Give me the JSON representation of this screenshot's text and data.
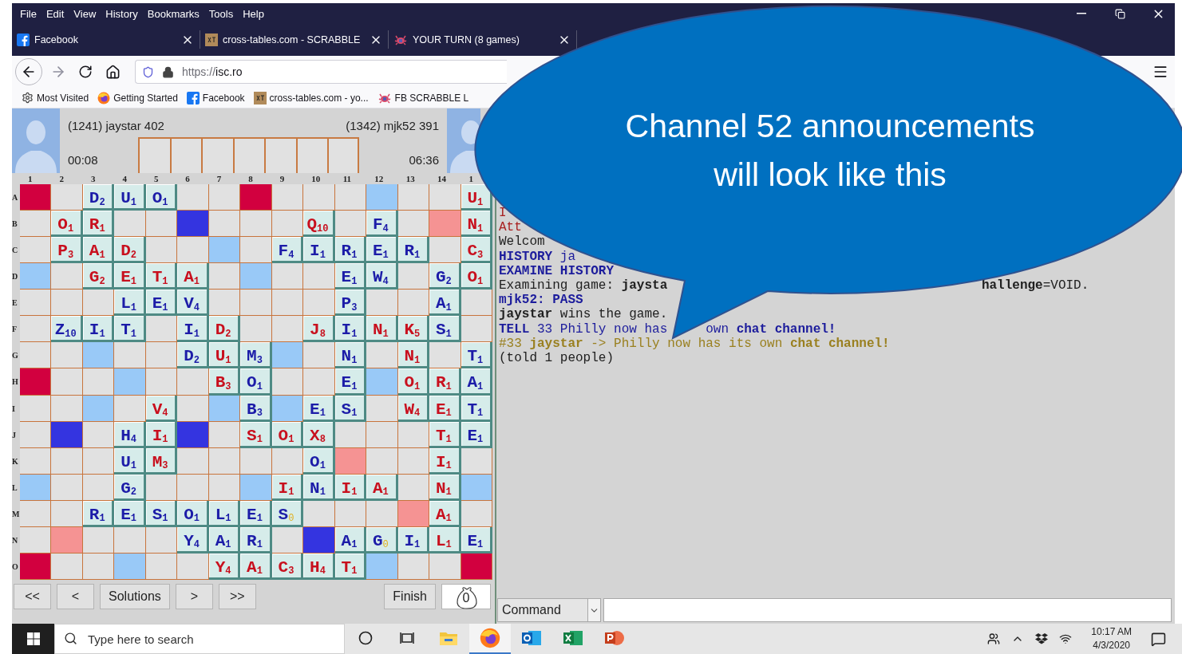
{
  "menu": [
    "File",
    "Edit",
    "View",
    "History",
    "Bookmarks",
    "Tools",
    "Help"
  ],
  "tabs": [
    {
      "kind": "facebook",
      "title": "Facebook",
      "selected": false
    },
    {
      "kind": "xt",
      "title": "cross-tables.com - SCRABBLE",
      "selected": false
    },
    {
      "kind": "crab",
      "title": "YOUR TURN (8 games)",
      "selected": false
    }
  ],
  "address": {
    "scheme": "https://",
    "host": "isc.ro"
  },
  "bookmarks": [
    {
      "kind": "gear",
      "label": "Most Visited"
    },
    {
      "kind": "firefox",
      "label": "Getting Started"
    },
    {
      "kind": "facebook",
      "label": "Facebook"
    },
    {
      "kind": "xt",
      "label": "cross-tables.com - yo..."
    },
    {
      "kind": "crab",
      "label": "FB SCRABBLE L"
    }
  ],
  "players": [
    {
      "name": "(1241) jaystar 402",
      "clock": "00:08"
    },
    {
      "name": "(1342) mjk52 391",
      "clock": "06:36"
    }
  ],
  "columns": [
    "1",
    "2",
    "3",
    "4",
    "5",
    "6",
    "7",
    "8",
    "9",
    "10",
    "11",
    "12",
    "13",
    "14",
    "1"
  ],
  "rows": [
    {
      "label": "A",
      "cells": [
        {
          "kind": "tw"
        },
        {
          "kind": "plain"
        },
        {
          "kind": "tile",
          "letter": "D",
          "points": "2",
          "color": "#1c1ca8"
        },
        {
          "kind": "tile",
          "letter": "U",
          "points": "1",
          "color": "#1c1ca8"
        },
        {
          "kind": "tile",
          "letter": "O",
          "points": "1",
          "color": "#1c1ca8"
        },
        {
          "kind": "plain"
        },
        {
          "kind": "plain"
        },
        {
          "kind": "tw"
        },
        {
          "kind": "plain"
        },
        {
          "kind": "plain"
        },
        {
          "kind": "plain"
        },
        {
          "kind": "dl"
        },
        {
          "kind": "plain"
        },
        {
          "kind": "plain"
        },
        {
          "kind": "tile",
          "letter": "U",
          "points": "1",
          "color": "#c8101e"
        }
      ]
    },
    {
      "label": "B",
      "cells": [
        {
          "kind": "plain"
        },
        {
          "kind": "tile",
          "letter": "O",
          "points": "1",
          "color": "#c8101e"
        },
        {
          "kind": "tile",
          "letter": "R",
          "points": "1",
          "color": "#c8101e"
        },
        {
          "kind": "plain"
        },
        {
          "kind": "plain"
        },
        {
          "kind": "tl"
        },
        {
          "kind": "plain"
        },
        {
          "kind": "plain"
        },
        {
          "kind": "plain"
        },
        {
          "kind": "tile",
          "letter": "Q",
          "points": "10",
          "color": "#c8101e"
        },
        {
          "kind": "plain"
        },
        {
          "kind": "tile",
          "letter": "F",
          "points": "4",
          "color": "#1c1ca8"
        },
        {
          "kind": "plain"
        },
        {
          "kind": "dw"
        },
        {
          "kind": "tile",
          "letter": "N",
          "points": "1",
          "color": "#c8101e"
        }
      ]
    },
    {
      "label": "C",
      "cells": [
        {
          "kind": "plain"
        },
        {
          "kind": "tile",
          "letter": "P",
          "points": "3",
          "color": "#c8101e"
        },
        {
          "kind": "tile",
          "letter": "A",
          "points": "1",
          "color": "#c8101e"
        },
        {
          "kind": "tile",
          "letter": "D",
          "points": "2",
          "color": "#c8101e"
        },
        {
          "kind": "plain"
        },
        {
          "kind": "plain"
        },
        {
          "kind": "dl"
        },
        {
          "kind": "plain"
        },
        {
          "kind": "tile",
          "letter": "F",
          "points": "4",
          "color": "#1c1ca8"
        },
        {
          "kind": "tile",
          "letter": "I",
          "points": "1",
          "color": "#1c1ca8"
        },
        {
          "kind": "tile",
          "letter": "R",
          "points": "1",
          "color": "#1c1ca8"
        },
        {
          "kind": "tile",
          "letter": "E",
          "points": "1",
          "color": "#1c1ca8"
        },
        {
          "kind": "tile",
          "letter": "R",
          "points": "1",
          "color": "#1c1ca8"
        },
        {
          "kind": "plain"
        },
        {
          "kind": "tile",
          "letter": "C",
          "points": "3",
          "color": "#c8101e"
        }
      ]
    },
    {
      "label": "D",
      "cells": [
        {
          "kind": "dl"
        },
        {
          "kind": "plain"
        },
        {
          "kind": "tile",
          "letter": "G",
          "points": "2",
          "color": "#c8101e"
        },
        {
          "kind": "tile",
          "letter": "E",
          "points": "1",
          "color": "#c8101e"
        },
        {
          "kind": "tile",
          "letter": "T",
          "points": "1",
          "color": "#c8101e"
        },
        {
          "kind": "tile",
          "letter": "A",
          "points": "1",
          "color": "#c8101e"
        },
        {
          "kind": "plain"
        },
        {
          "kind": "dl"
        },
        {
          "kind": "plain"
        },
        {
          "kind": "plain"
        },
        {
          "kind": "tile",
          "letter": "E",
          "points": "1",
          "color": "#1c1ca8"
        },
        {
          "kind": "tile",
          "letter": "W",
          "points": "4",
          "color": "#1c1ca8"
        },
        {
          "kind": "plain"
        },
        {
          "kind": "tile",
          "letter": "G",
          "points": "2",
          "color": "#1c1ca8"
        },
        {
          "kind": "tile",
          "letter": "O",
          "points": "1",
          "color": "#c8101e"
        }
      ]
    },
    {
      "label": "E",
      "cells": [
        {
          "kind": "plain"
        },
        {
          "kind": "plain"
        },
        {
          "kind": "plain"
        },
        {
          "kind": "tile",
          "letter": "L",
          "points": "1",
          "color": "#1c1ca8"
        },
        {
          "kind": "tile",
          "letter": "E",
          "points": "1",
          "color": "#1c1ca8"
        },
        {
          "kind": "tile",
          "letter": "V",
          "points": "4",
          "color": "#1c1ca8"
        },
        {
          "kind": "plain"
        },
        {
          "kind": "plain"
        },
        {
          "kind": "plain"
        },
        {
          "kind": "plain"
        },
        {
          "kind": "tile",
          "letter": "P",
          "points": "3",
          "color": "#1c1ca8"
        },
        {
          "kind": "plain"
        },
        {
          "kind": "plain"
        },
        {
          "kind": "tile",
          "letter": "A",
          "points": "1",
          "color": "#1c1ca8"
        },
        {
          "kind": "plain"
        }
      ]
    },
    {
      "label": "F",
      "cells": [
        {
          "kind": "plain"
        },
        {
          "kind": "tile",
          "letter": "Z",
          "points": "10",
          "color": "#1c1ca8"
        },
        {
          "kind": "tile",
          "letter": "I",
          "points": "1",
          "color": "#1c1ca8"
        },
        {
          "kind": "tile",
          "letter": "T",
          "points": "1",
          "color": "#1c1ca8"
        },
        {
          "kind": "plain"
        },
        {
          "kind": "tile",
          "letter": "I",
          "points": "1",
          "color": "#1c1ca8"
        },
        {
          "kind": "tile",
          "letter": "D",
          "points": "2",
          "color": "#c8101e"
        },
        {
          "kind": "plain"
        },
        {
          "kind": "plain"
        },
        {
          "kind": "tile",
          "letter": "J",
          "points": "8",
          "color": "#c8101e"
        },
        {
          "kind": "tile",
          "letter": "I",
          "points": "1",
          "color": "#1c1ca8"
        },
        {
          "kind": "tile",
          "letter": "N",
          "points": "1",
          "color": "#c8101e"
        },
        {
          "kind": "tile",
          "letter": "K",
          "points": "5",
          "color": "#c8101e"
        },
        {
          "kind": "tile",
          "letter": "S",
          "points": "1",
          "color": "#1c1ca8"
        },
        {
          "kind": "plain"
        }
      ]
    },
    {
      "label": "G",
      "cells": [
        {
          "kind": "plain"
        },
        {
          "kind": "plain"
        },
        {
          "kind": "dl"
        },
        {
          "kind": "plain"
        },
        {
          "kind": "plain"
        },
        {
          "kind": "tile",
          "letter": "D",
          "points": "2",
          "color": "#1c1ca8"
        },
        {
          "kind": "tile",
          "letter": "U",
          "points": "1",
          "color": "#c8101e"
        },
        {
          "kind": "tile",
          "letter": "M",
          "points": "3",
          "color": "#1c1ca8"
        },
        {
          "kind": "dl"
        },
        {
          "kind": "plain"
        },
        {
          "kind": "tile",
          "letter": "N",
          "points": "1",
          "color": "#1c1ca8"
        },
        {
          "kind": "plain"
        },
        {
          "kind": "tile",
          "letter": "N",
          "points": "1",
          "color": "#c8101e"
        },
        {
          "kind": "plain"
        },
        {
          "kind": "tile",
          "letter": "T",
          "points": "1",
          "color": "#1c1ca8"
        }
      ]
    },
    {
      "label": "H",
      "cells": [
        {
          "kind": "tw"
        },
        {
          "kind": "plain"
        },
        {
          "kind": "plain"
        },
        {
          "kind": "dl"
        },
        {
          "kind": "plain"
        },
        {
          "kind": "plain"
        },
        {
          "kind": "tile",
          "letter": "B",
          "points": "3",
          "color": "#c8101e"
        },
        {
          "kind": "tile",
          "letter": "O",
          "points": "1",
          "color": "#1c1ca8"
        },
        {
          "kind": "plain"
        },
        {
          "kind": "plain"
        },
        {
          "kind": "tile",
          "letter": "E",
          "points": "1",
          "color": "#1c1ca8"
        },
        {
          "kind": "dl"
        },
        {
          "kind": "tile",
          "letter": "O",
          "points": "1",
          "color": "#c8101e"
        },
        {
          "kind": "tile",
          "letter": "R",
          "points": "1",
          "color": "#c8101e"
        },
        {
          "kind": "tile",
          "letter": "A",
          "points": "1",
          "color": "#1c1ca8"
        }
      ]
    },
    {
      "label": "I",
      "cells": [
        {
          "kind": "plain"
        },
        {
          "kind": "plain"
        },
        {
          "kind": "dl"
        },
        {
          "kind": "plain"
        },
        {
          "kind": "tile",
          "letter": "V",
          "points": "4",
          "color": "#c8101e"
        },
        {
          "kind": "plain"
        },
        {
          "kind": "dl"
        },
        {
          "kind": "tile",
          "letter": "B",
          "points": "3",
          "color": "#1c1ca8"
        },
        {
          "kind": "dl"
        },
        {
          "kind": "tile",
          "letter": "E",
          "points": "1",
          "color": "#1c1ca8"
        },
        {
          "kind": "tile",
          "letter": "S",
          "points": "1",
          "color": "#1c1ca8"
        },
        {
          "kind": "plain"
        },
        {
          "kind": "tile",
          "letter": "W",
          "points": "4",
          "color": "#c8101e"
        },
        {
          "kind": "tile",
          "letter": "E",
          "points": "1",
          "color": "#c8101e"
        },
        {
          "kind": "tile",
          "letter": "T",
          "points": "1",
          "color": "#1c1ca8"
        }
      ]
    },
    {
      "label": "J",
      "cells": [
        {
          "kind": "plain"
        },
        {
          "kind": "tl"
        },
        {
          "kind": "plain"
        },
        {
          "kind": "tile",
          "letter": "H",
          "points": "4",
          "color": "#1c1ca8"
        },
        {
          "kind": "tile",
          "letter": "I",
          "points": "1",
          "color": "#c8101e"
        },
        {
          "kind": "tl"
        },
        {
          "kind": "plain"
        },
        {
          "kind": "tile",
          "letter": "S",
          "points": "1",
          "color": "#c8101e"
        },
        {
          "kind": "tile",
          "letter": "O",
          "points": "1",
          "color": "#c8101e"
        },
        {
          "kind": "tile",
          "letter": "X",
          "points": "8",
          "color": "#c8101e"
        },
        {
          "kind": "plain"
        },
        {
          "kind": "plain"
        },
        {
          "kind": "plain"
        },
        {
          "kind": "tile",
          "letter": "T",
          "points": "1",
          "color": "#c8101e"
        },
        {
          "kind": "tile",
          "letter": "E",
          "points": "1",
          "color": "#1c1ca8"
        }
      ]
    },
    {
      "label": "K",
      "cells": [
        {
          "kind": "plain"
        },
        {
          "kind": "plain"
        },
        {
          "kind": "plain"
        },
        {
          "kind": "tile",
          "letter": "U",
          "points": "1",
          "color": "#1c1ca8"
        },
        {
          "kind": "tile",
          "letter": "M",
          "points": "3",
          "color": "#c8101e"
        },
        {
          "kind": "plain"
        },
        {
          "kind": "plain"
        },
        {
          "kind": "plain"
        },
        {
          "kind": "plain"
        },
        {
          "kind": "tile",
          "letter": "O",
          "points": "1",
          "color": "#1c1ca8"
        },
        {
          "kind": "dw"
        },
        {
          "kind": "plain"
        },
        {
          "kind": "plain"
        },
        {
          "kind": "tile",
          "letter": "I",
          "points": "1",
          "color": "#c8101e"
        },
        {
          "kind": "plain"
        }
      ]
    },
    {
      "label": "L",
      "cells": [
        {
          "kind": "dl"
        },
        {
          "kind": "plain"
        },
        {
          "kind": "plain"
        },
        {
          "kind": "tile",
          "letter": "G",
          "points": "2",
          "color": "#1c1ca8"
        },
        {
          "kind": "plain"
        },
        {
          "kind": "plain"
        },
        {
          "kind": "plain"
        },
        {
          "kind": "dl"
        },
        {
          "kind": "tile",
          "letter": "I",
          "points": "1",
          "color": "#c8101e"
        },
        {
          "kind": "tile",
          "letter": "N",
          "points": "1",
          "color": "#1c1ca8"
        },
        {
          "kind": "tile",
          "letter": "I",
          "points": "1",
          "color": "#c8101e"
        },
        {
          "kind": "tile",
          "letter": "A",
          "points": "1",
          "color": "#c8101e"
        },
        {
          "kind": "plain"
        },
        {
          "kind": "tile",
          "letter": "N",
          "points": "1",
          "color": "#c8101e"
        },
        {
          "kind": "dl"
        }
      ]
    },
    {
      "label": "M",
      "cells": [
        {
          "kind": "plain"
        },
        {
          "kind": "plain"
        },
        {
          "kind": "tile",
          "letter": "R",
          "points": "1",
          "color": "#1c1ca8"
        },
        {
          "kind": "tile",
          "letter": "E",
          "points": "1",
          "color": "#1c1ca8"
        },
        {
          "kind": "tile",
          "letter": "S",
          "points": "1",
          "color": "#1c1ca8"
        },
        {
          "kind": "tile",
          "letter": "O",
          "points": "1",
          "color": "#1c1ca8"
        },
        {
          "kind": "tile",
          "letter": "L",
          "points": "1",
          "color": "#1c1ca8"
        },
        {
          "kind": "tile",
          "letter": "E",
          "points": "1",
          "color": "#1c1ca8"
        },
        {
          "kind": "blank",
          "letter": "S",
          "points": "0",
          "color": "#1c1ca8"
        },
        {
          "kind": "plain"
        },
        {
          "kind": "plain"
        },
        {
          "kind": "plain"
        },
        {
          "kind": "dw"
        },
        {
          "kind": "tile",
          "letter": "A",
          "points": "1",
          "color": "#c8101e"
        },
        {
          "kind": "plain"
        }
      ]
    },
    {
      "label": "N",
      "cells": [
        {
          "kind": "plain"
        },
        {
          "kind": "dw"
        },
        {
          "kind": "plain"
        },
        {
          "kind": "plain"
        },
        {
          "kind": "plain"
        },
        {
          "kind": "tile",
          "letter": "Y",
          "points": "4",
          "color": "#1c1ca8"
        },
        {
          "kind": "tile",
          "letter": "A",
          "points": "1",
          "color": "#1c1ca8"
        },
        {
          "kind": "tile",
          "letter": "R",
          "points": "1",
          "color": "#1c1ca8"
        },
        {
          "kind": "plain"
        },
        {
          "kind": "tl"
        },
        {
          "kind": "tile",
          "letter": "A",
          "points": "1",
          "color": "#1c1ca8"
        },
        {
          "kind": "blank",
          "letter": "G",
          "points": "0",
          "color": "#1c1ca8"
        },
        {
          "kind": "tile",
          "letter": "I",
          "points": "1",
          "color": "#1c1ca8"
        },
        {
          "kind": "tile",
          "letter": "L",
          "points": "1",
          "color": "#c8101e"
        },
        {
          "kind": "tile",
          "letter": "E",
          "points": "1",
          "color": "#1c1ca8"
        }
      ]
    },
    {
      "label": "O",
      "cells": [
        {
          "kind": "tw"
        },
        {
          "kind": "plain"
        },
        {
          "kind": "plain"
        },
        {
          "kind": "dl"
        },
        {
          "kind": "plain"
        },
        {
          "kind": "plain"
        },
        {
          "kind": "tile",
          "letter": "Y",
          "points": "4",
          "color": "#c8101e"
        },
        {
          "kind": "tile",
          "letter": "A",
          "points": "1",
          "color": "#c8101e"
        },
        {
          "kind": "tile",
          "letter": "C",
          "points": "3",
          "color": "#c8101e"
        },
        {
          "kind": "tile",
          "letter": "H",
          "points": "4",
          "color": "#c8101e"
        },
        {
          "kind": "tile",
          "letter": "T",
          "points": "1",
          "color": "#c8101e"
        },
        {
          "kind": "dl"
        },
        {
          "kind": "plain"
        },
        {
          "kind": "plain"
        },
        {
          "kind": "tw"
        }
      ]
    }
  ],
  "nav_buttons": [
    "<<",
    "<",
    "Solutions",
    ">",
    ">>"
  ],
  "finish": "Finish",
  "bag_count": "0",
  "chat": [
    {
      "color": "#a82020",
      "parts": [
        "I"
      ]
    },
    {
      "color": "#a82020",
      "parts": [
        "Att"
      ]
    },
    {
      "color": "#202020",
      "parts": [
        "Welcom"
      ]
    },
    {
      "color": "#1c1c9c",
      "parts": [
        "**HISTORY** ja"
      ]
    },
    {
      "color": "#1c1c9c",
      "parts": [
        "**EXAMINE HISTORY**"
      ]
    },
    {
      "color": "#202020",
      "parts": [
        "Examining game: **jaysta**",
        "**hallenge**=VOID."
      ]
    },
    {
      "color": "#1c1c9c",
      "parts": [
        "**mjk52: PASS**"
      ]
    },
    {
      "color": "#202020",
      "parts": [
        "**jaystar** wins the game."
      ]
    },
    {
      "color": "#1c1c9c",
      "parts": [
        "**TELL** 33 Philly now has",
        "own **chat channel!**"
      ]
    },
    {
      "color": "#9a8020",
      "parts": [
        "#33 **jaystar** -> Philly now has its own **chat channel!**"
      ]
    },
    {
      "color": "#202020",
      "parts": [
        "(told 1 people)"
      ]
    }
  ],
  "command": {
    "value": "Command"
  },
  "callout": [
    "Channel 52 announcements",
    "will look like this"
  ],
  "taskbar": {
    "search_placeholder": "Type here to search",
    "apps": [
      {
        "kind": "cortana",
        "selected": false
      },
      {
        "kind": "taskview",
        "selected": false
      },
      {
        "kind": "explorer",
        "selected": false
      },
      {
        "kind": "firefox",
        "selected": true
      },
      {
        "kind": "outlook",
        "selected": false
      },
      {
        "kind": "excel",
        "selected": false
      },
      {
        "kind": "powerpoint",
        "selected": false
      }
    ],
    "time": "10:17 AM",
    "date": "4/3/2020"
  }
}
